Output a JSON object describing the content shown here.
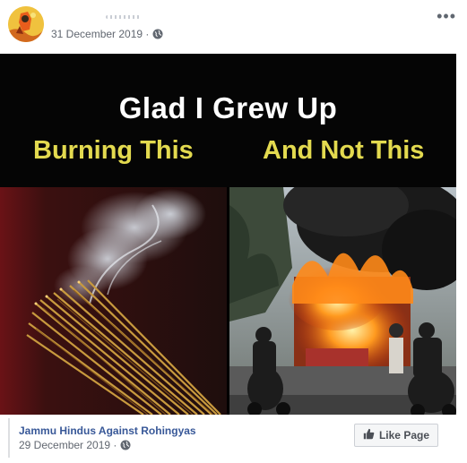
{
  "post": {
    "date": "31 December 2019 ·",
    "privacy_icon": "globe-icon",
    "more_icon": "more-options-icon"
  },
  "image": {
    "line1": "Glad I Grew Up",
    "line2_left": "Burning This",
    "line2_right": "And Not This"
  },
  "shared": {
    "page_name": "Jammu Hindus Against Rohingyas",
    "date": "29 December 2019 ·",
    "like_label": "Like Page",
    "like_icon": "thumbs-up-icon"
  },
  "colors": {
    "caption_yellow": "#e3da4f",
    "link_blue": "#385898",
    "meta_gray": "#616770"
  }
}
